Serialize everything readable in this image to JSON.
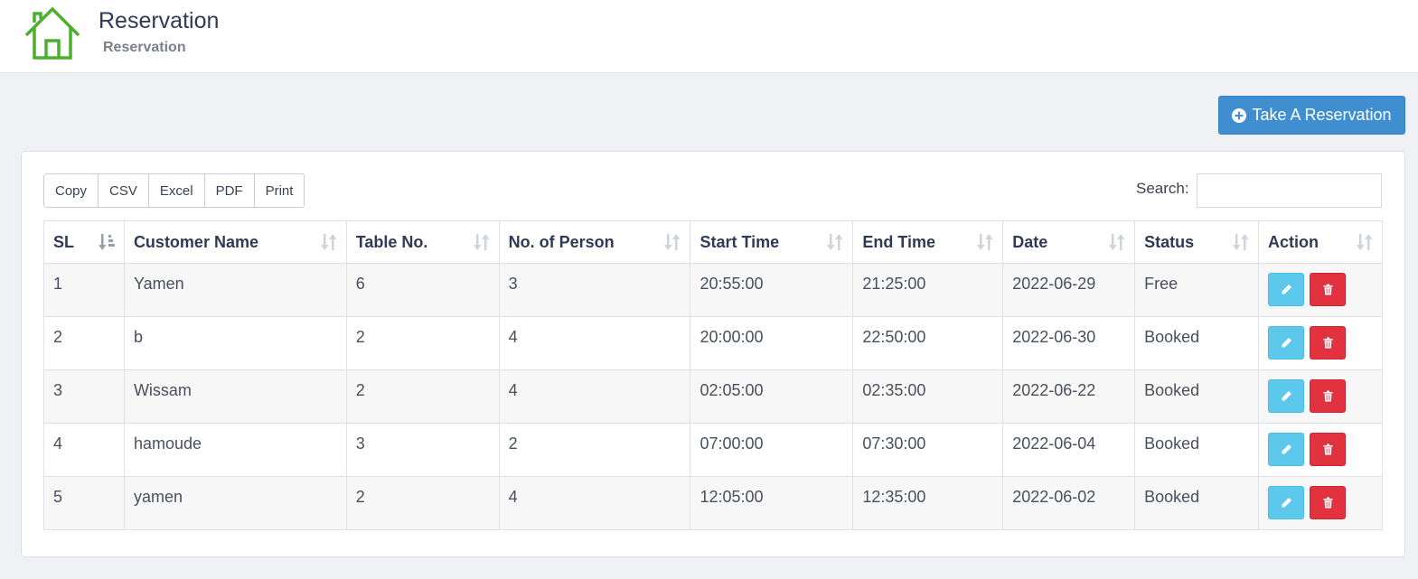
{
  "header": {
    "title": "Reservation",
    "subtitle": "Reservation"
  },
  "actions": {
    "take_reservation_label": "Take A Reservation"
  },
  "export_buttons": [
    "Copy",
    "CSV",
    "Excel",
    "PDF",
    "Print"
  ],
  "search": {
    "label": "Search:",
    "value": ""
  },
  "table": {
    "columns": [
      "SL",
      "Customer Name",
      "Table No.",
      "No. of Person",
      "Start Time",
      "End Time",
      "Date",
      "Status",
      "Action"
    ],
    "rows": [
      [
        "1",
        "Yamen",
        "6",
        "3",
        "20:55:00",
        "21:25:00",
        "2022-06-29",
        "Free"
      ],
      [
        "2",
        "b",
        "2",
        "4",
        "20:00:00",
        "22:50:00",
        "2022-06-30",
        "Booked"
      ],
      [
        "3",
        "Wissam",
        "2",
        "4",
        "02:05:00",
        "02:35:00",
        "2022-06-22",
        "Booked"
      ],
      [
        "4",
        "hamoude",
        "3",
        "2",
        "07:00:00",
        "07:30:00",
        "2022-06-04",
        "Booked"
      ],
      [
        "5",
        "yamen",
        "2",
        "4",
        "12:05:00",
        "12:35:00",
        "2022-06-02",
        "Booked"
      ]
    ]
  },
  "icons": {
    "home": "home-icon",
    "add": "plus-circle-icon",
    "sort": "sort-icon",
    "sort_active": "sort-numeric-asc-icon",
    "edit": "pencil-icon",
    "delete": "trash-icon"
  },
  "colors": {
    "brand_green": "#4caf2e",
    "primary": "#3e8ed0",
    "info": "#5bc8ec",
    "danger": "#e2323f"
  }
}
